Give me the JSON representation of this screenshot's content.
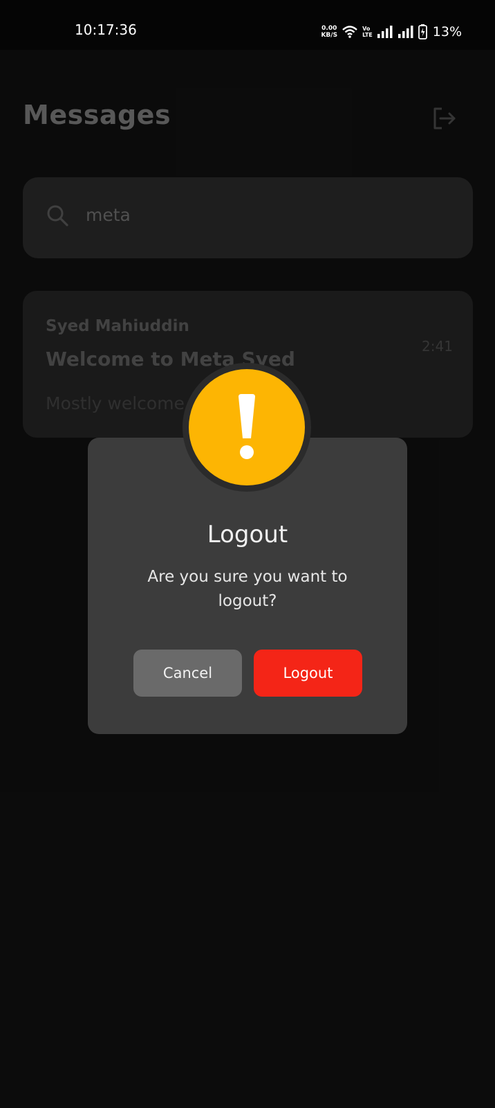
{
  "status_bar": {
    "time": "10:17:36",
    "net_speed_value": "0.00",
    "net_speed_unit": "KB/S",
    "volte_top": "Vo",
    "volte_bottom": "LTE",
    "battery_percent": "13%"
  },
  "header": {
    "title": "Messages",
    "action_icon": "logout-icon"
  },
  "search": {
    "icon": "search-icon",
    "value": "meta"
  },
  "messages": [
    {
      "sender": "Syed Mahiuddin",
      "subject": "Welcome to Meta Syed",
      "preview": "Mostly welcome to the team.",
      "time": "2:41"
    }
  ],
  "dialog": {
    "icon": "warning-icon",
    "icon_color": "#fdb503",
    "title": "Logout",
    "message": "Are you sure you want to logout?",
    "cancel_label": "Cancel",
    "confirm_label": "Logout",
    "confirm_color": "#f42517"
  }
}
